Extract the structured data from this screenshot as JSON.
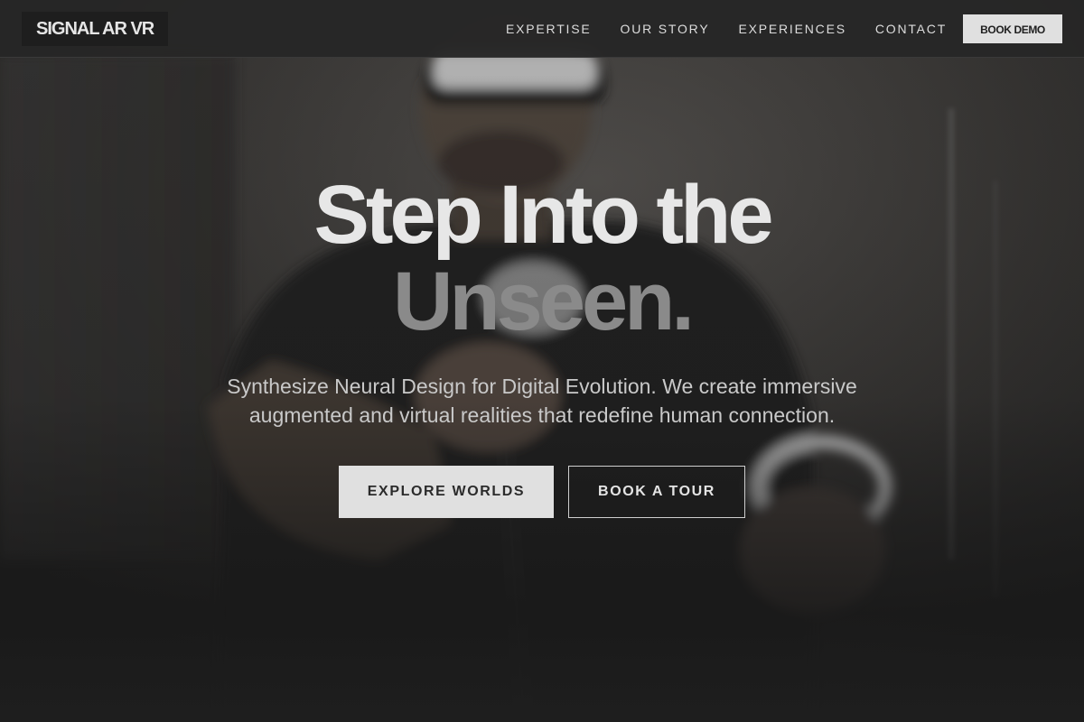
{
  "nav": {
    "logo_text": "SIGNAL AR VR",
    "links": [
      "EXPERTISE",
      "OUR STORY",
      "EXPERIENCES",
      "CONTACT"
    ],
    "cta_label": "BOOK DEMO"
  },
  "hero": {
    "title_line_1": "Step Into the",
    "title_line_2": "Unseen.",
    "subtitle": "Synthesize Neural Design for Digital Evolution. We create immersive augmented and virtual realities that redefine human connection.",
    "primary_button": "EXPLORE WORLDS",
    "secondary_button": "BOOK A TOUR",
    "background_image": "person wearing a VR headset holding controllers, dark monochrome photo"
  },
  "colors": {
    "page_background": "#202020",
    "navbar_background": "#262626",
    "button_light": "#e0e0e0",
    "title_primary": "#e7e7e7",
    "title_secondary": "#8a8a8a"
  }
}
